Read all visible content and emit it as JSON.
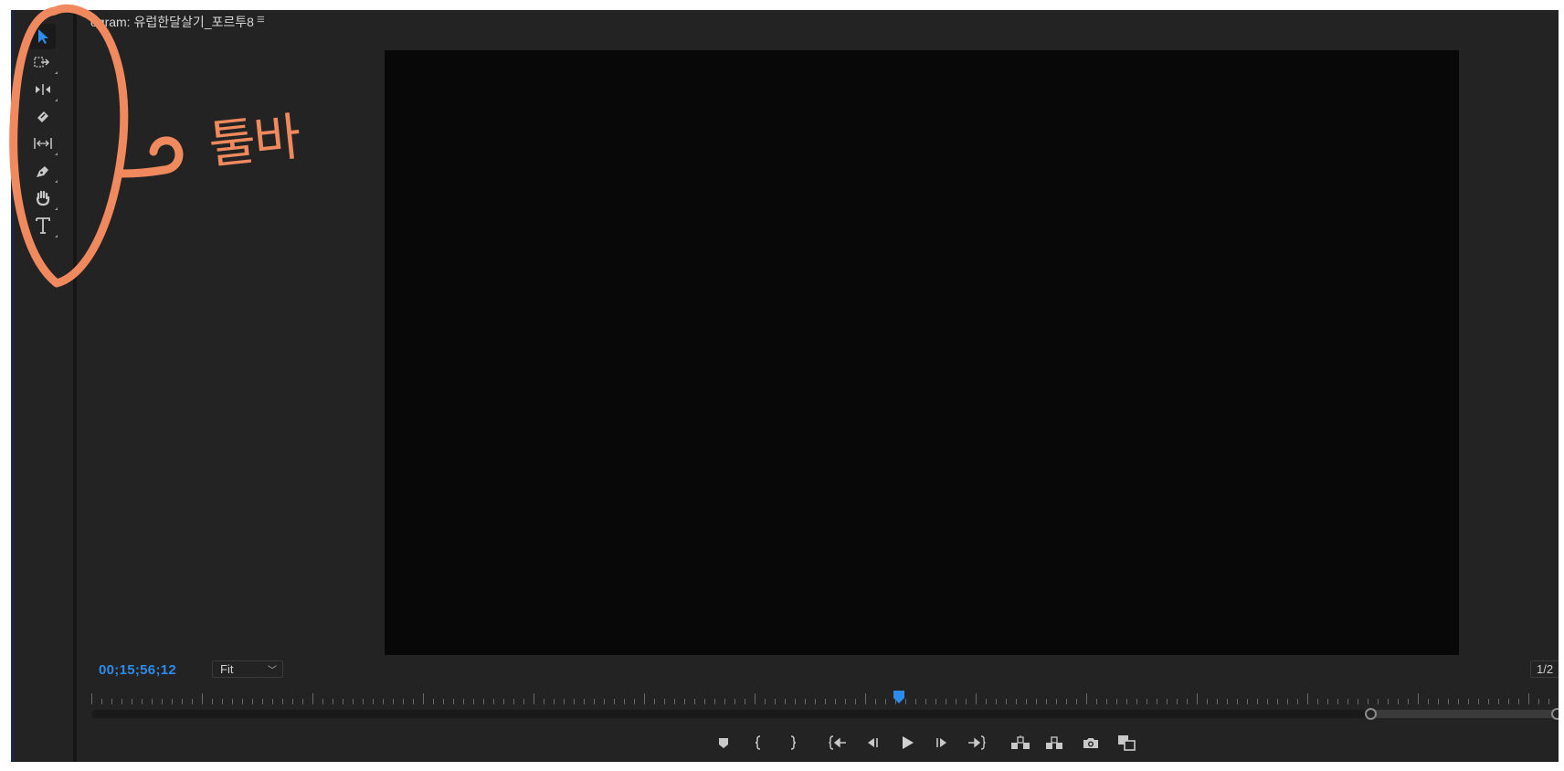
{
  "panel": {
    "title": "ogram: 유럽한달살기_포르투8",
    "menu_icon": "hamburger-menu-icon"
  },
  "toolbar": {
    "tools": [
      {
        "id": "selection",
        "icon": "selection-arrow-icon",
        "active": true
      },
      {
        "id": "track-select",
        "icon": "track-select-forward-icon",
        "active": false
      },
      {
        "id": "ripple-edit",
        "icon": "ripple-edit-icon",
        "active": false
      },
      {
        "id": "razor",
        "icon": "razor-icon",
        "active": false
      },
      {
        "id": "slip",
        "icon": "slip-icon",
        "active": false
      },
      {
        "id": "pen",
        "icon": "pen-icon",
        "active": false
      },
      {
        "id": "hand",
        "icon": "hand-icon",
        "active": false
      },
      {
        "id": "type",
        "icon": "type-icon",
        "active": false
      }
    ]
  },
  "monitor": {
    "timecode": "00;15;56;12",
    "zoom": "Fit",
    "resolution": "1/2"
  },
  "transport": {
    "buttons": [
      {
        "id": "add-marker",
        "icon": "marker-icon"
      },
      {
        "id": "mark-in",
        "icon": "mark-in-icon"
      },
      {
        "id": "mark-out",
        "icon": "mark-out-icon"
      },
      {
        "id": "go-to-in",
        "icon": "go-to-in-icon"
      },
      {
        "id": "step-back",
        "icon": "step-back-icon"
      },
      {
        "id": "play",
        "icon": "play-icon"
      },
      {
        "id": "step-forward",
        "icon": "step-forward-icon"
      },
      {
        "id": "go-to-out",
        "icon": "go-to-out-icon"
      },
      {
        "id": "lift",
        "icon": "lift-icon"
      },
      {
        "id": "extract",
        "icon": "extract-icon"
      },
      {
        "id": "export-frame",
        "icon": "camera-icon"
      },
      {
        "id": "comparison-view",
        "icon": "comparison-view-icon"
      }
    ]
  },
  "annotation": {
    "label": "툴바",
    "color": "#f08a5e"
  },
  "colors": {
    "panel_bg": "#232323",
    "monitor_bg": "#080808",
    "accent": "#2d8ceb"
  }
}
